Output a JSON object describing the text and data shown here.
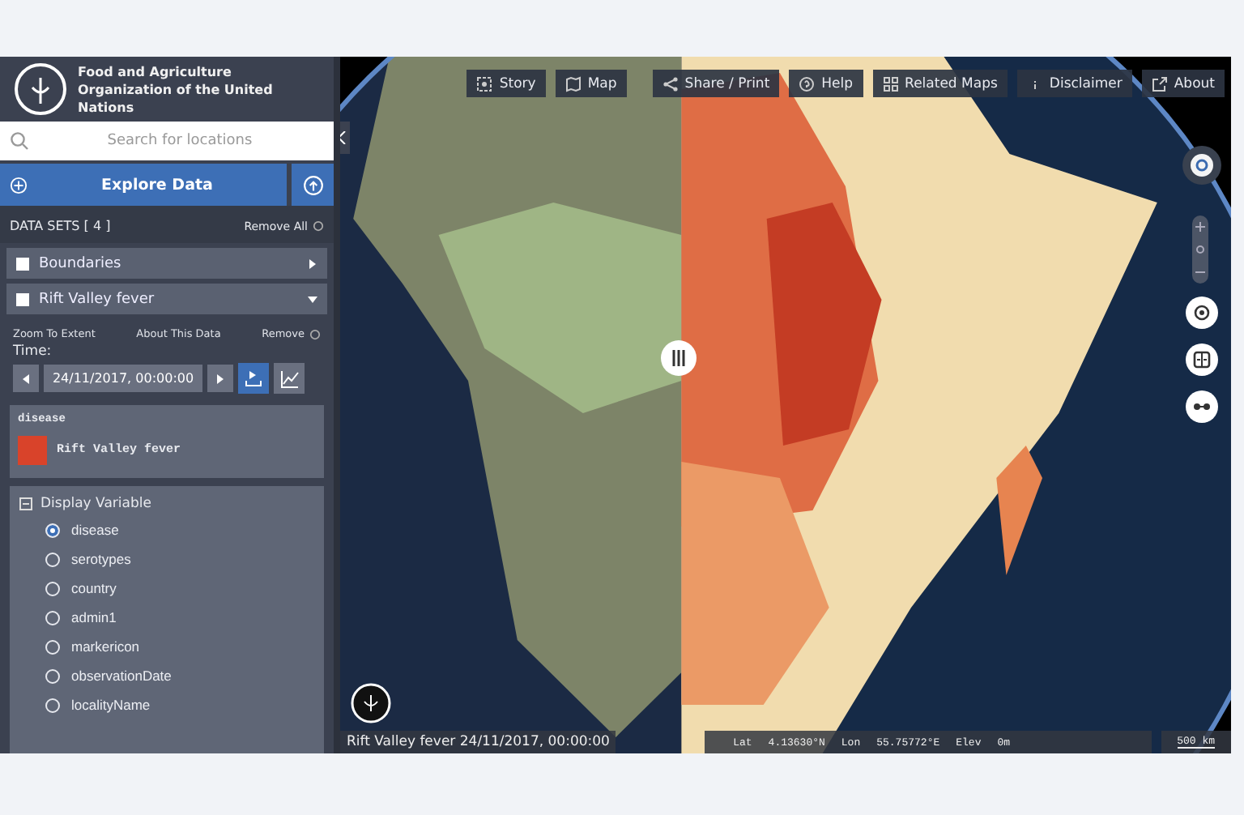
{
  "sidebar": {
    "org_name": "Food and Agriculture Organization of the United Nations",
    "search": {
      "placeholder": "Search for locations"
    },
    "explore_button": "Explore Data",
    "datasets_header": "DATA SETS  [ 4 ]",
    "remove_all": "Remove All",
    "datasets": [
      {
        "label": "Boundaries",
        "expanded": false
      },
      {
        "label": "Rift Valley fever",
        "expanded": true
      }
    ],
    "dataset_actions": [
      "Zoom To Extent",
      "About This Data",
      "Remove"
    ],
    "time_label": "Time:",
    "time_value": "24/11/2017, 00:00:00",
    "legend": {
      "title": "disease",
      "items": [
        {
          "label": "Rift Valley fever",
          "color": "#d9432a"
        }
      ]
    },
    "display_variable": {
      "title": "Display Variable",
      "options": [
        {
          "label": "disease",
          "selected": true
        },
        {
          "label": "serotypes",
          "selected": false
        },
        {
          "label": "country",
          "selected": false
        },
        {
          "label": "admin1",
          "selected": false
        },
        {
          "label": "markericon",
          "selected": false
        },
        {
          "label": "observationDate",
          "selected": false
        },
        {
          "label": "localityName",
          "selected": false
        }
      ]
    }
  },
  "map": {
    "toolbar": [
      {
        "label": "Story",
        "kind": "story"
      },
      {
        "label": "Map",
        "kind": "map"
      },
      {
        "label": "Share / Print",
        "kind": "share"
      },
      {
        "label": "Help",
        "kind": "help"
      },
      {
        "label": "Related Maps",
        "kind": "grid"
      },
      {
        "label": "Disclaimer",
        "kind": "info"
      },
      {
        "label": "About",
        "kind": "external"
      }
    ],
    "status_caption": "Rift Valley fever 24/11/2017, 00:00:00",
    "coordinates": {
      "lat_label": "Lat",
      "lat": "4.13630°N",
      "lon_label": "Lon",
      "lon": "55.75772°E",
      "elev_label": "Elev",
      "elev": "0m"
    },
    "scale": "500 km"
  }
}
